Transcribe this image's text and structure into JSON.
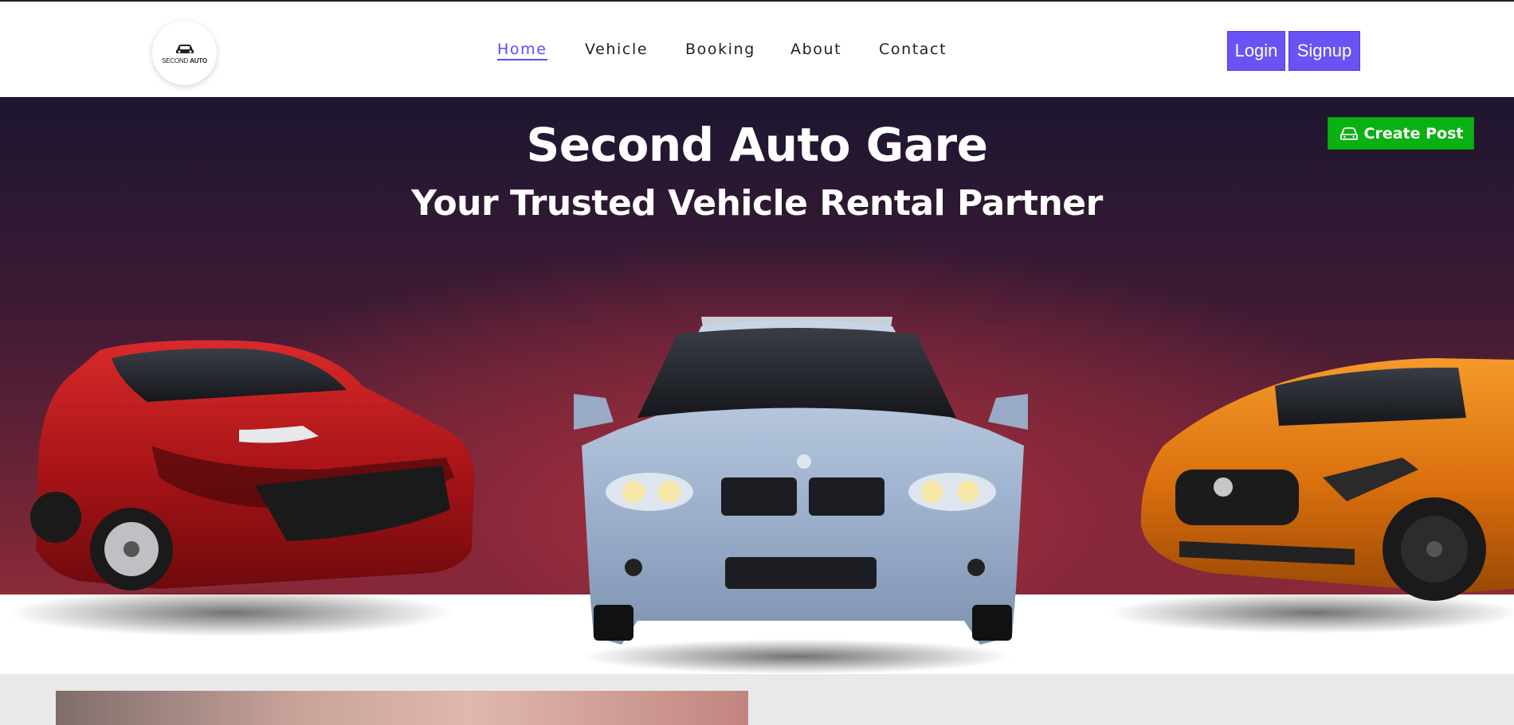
{
  "brand": {
    "logo_line1": "SECOND",
    "logo_line2": "AUTO"
  },
  "nav": {
    "items": [
      {
        "label": "Home",
        "active": true
      },
      {
        "label": "Vehicle",
        "active": false
      },
      {
        "label": "Booking",
        "active": false
      },
      {
        "label": "About",
        "active": false
      },
      {
        "label": "Contact",
        "active": false
      }
    ]
  },
  "auth": {
    "login_label": "Login",
    "signup_label": "Signup"
  },
  "hero": {
    "title": "Second Auto Gare",
    "subtitle": "Your Trusted Vehicle Rental Partner",
    "create_post_label": "Create Post",
    "create_post_icon": "car-icon"
  },
  "colors": {
    "accent": "#6a53f5",
    "nav_active": "#5a4bff",
    "create_post": "#0bb012",
    "car_red": "#b3141b",
    "car_silver": "#a9bcd6",
    "car_orange": "#e07a12"
  }
}
